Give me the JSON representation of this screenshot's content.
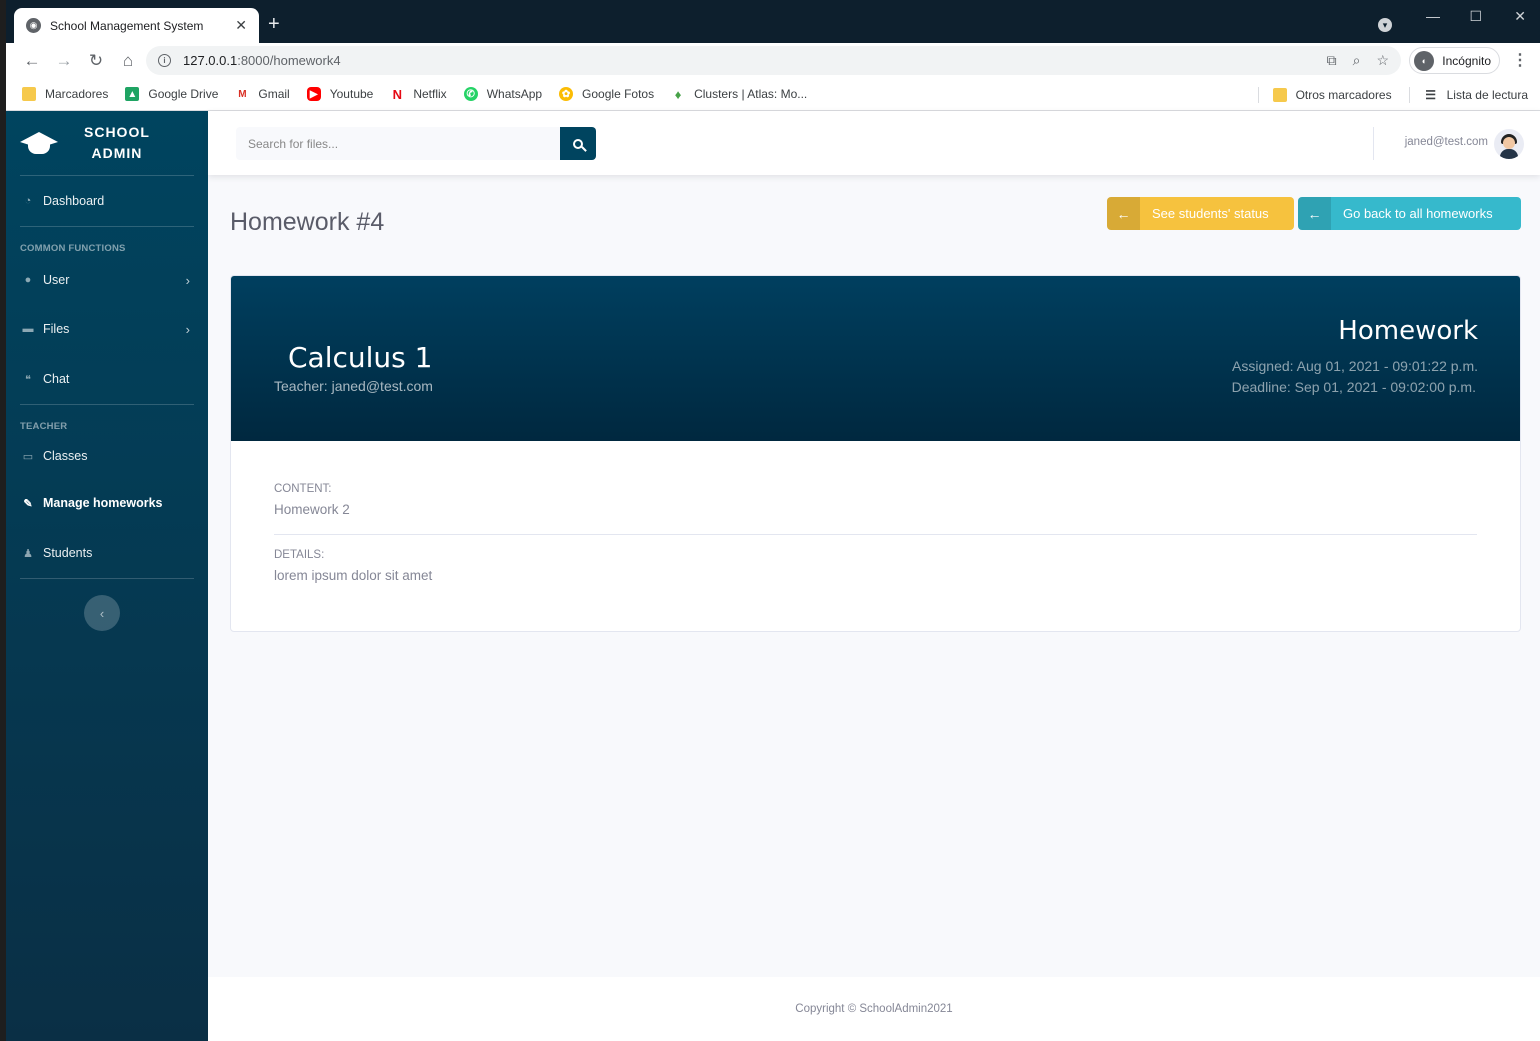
{
  "browser": {
    "tab_title": "School Management System",
    "url_host": "127.0.0.1",
    "url_path": ":8000/homework4",
    "incognito_label": "Incógnito",
    "bookmarks": [
      {
        "label": "Marcadores",
        "icon": "folder-icon",
        "color": "#f6c94c"
      },
      {
        "label": "Google Drive",
        "icon": "google-drive-icon",
        "color": "#1fa463"
      },
      {
        "label": "Gmail",
        "icon": "gmail-icon",
        "color": "#d93025"
      },
      {
        "label": "Youtube",
        "icon": "youtube-icon",
        "color": "#ff0000"
      },
      {
        "label": "Netflix",
        "icon": "netflix-icon",
        "color": "#e50914"
      },
      {
        "label": "WhatsApp",
        "icon": "whatsapp-icon",
        "color": "#25d366"
      },
      {
        "label": "Google Fotos",
        "icon": "google-photos-icon",
        "color": "#fbbc04"
      },
      {
        "label": "Clusters | Atlas: Mo...",
        "icon": "mongodb-leaf-icon",
        "color": "#47a248"
      }
    ],
    "bookmarks_right": [
      {
        "label": "Otros marcadores",
        "icon": "folder-icon"
      },
      {
        "label": "Lista de lectura",
        "icon": "reading-list-icon"
      }
    ]
  },
  "sidebar": {
    "brand_line1": "SCHOOL",
    "brand_line2": "ADMIN",
    "dashboard": "Dashboard",
    "heading_common": "COMMON FUNCTIONS",
    "user": "User",
    "files": "Files",
    "chat": "Chat",
    "heading_teacher": "TEACHER",
    "classes": "Classes",
    "manage_homeworks": "Manage homeworks",
    "students": "Students"
  },
  "topbar": {
    "search_placeholder": "Search for files...",
    "user_email": "janed@test.com"
  },
  "page": {
    "title": "Homework #4",
    "btn_status": "See students' status",
    "btn_back": "Go back to all homeworks",
    "course": "Calculus 1",
    "teacher": "Teacher: janed@test.com",
    "hw_label": "Homework",
    "assigned": "Assigned: Aug 01, 2021 - 09:01:22 p.m.",
    "deadline": "Deadline: Sep 01, 2021 - 09:02:00 p.m.",
    "content_label": "CONTENT:",
    "content_value": "Homework 2",
    "details_label": "DETAILS:",
    "details_value": "lorem ipsum dolor sit amet"
  },
  "footer": {
    "copyright": "Copyright © SchoolAdmin2021"
  },
  "colors": {
    "primary": "#00445f",
    "warning": "#f6c23e",
    "info": "#36b9cc"
  }
}
